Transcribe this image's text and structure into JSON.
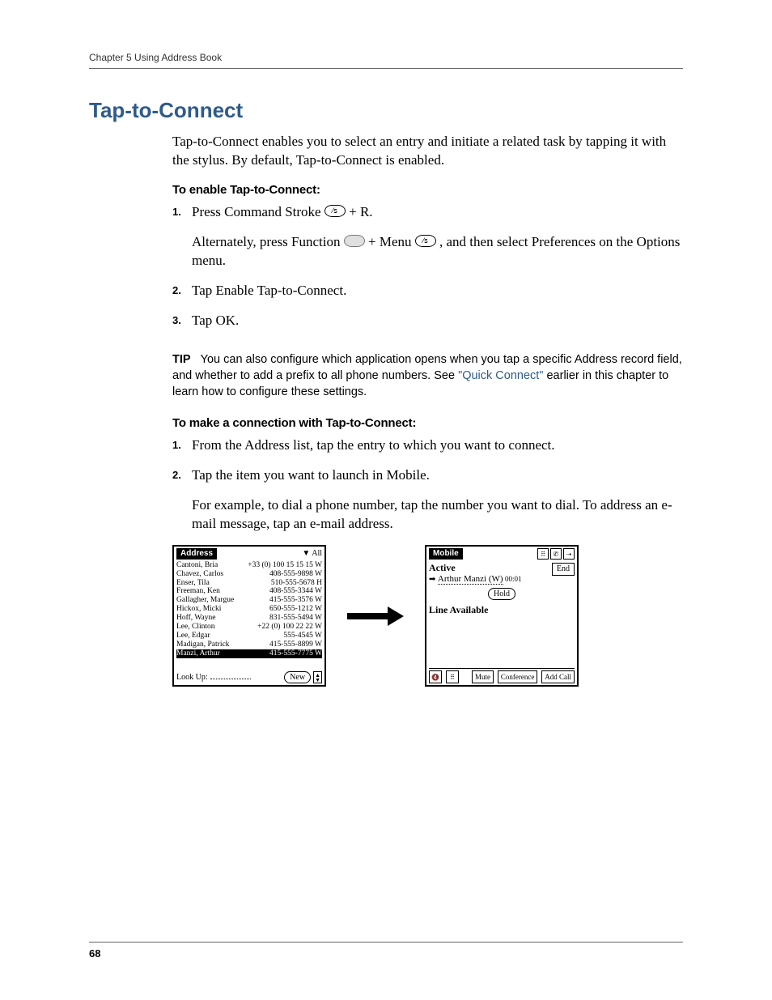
{
  "header": {
    "chapter": "Chapter 5   Using Address Book"
  },
  "section": {
    "title": "Tap-to-Connect"
  },
  "intro": "Tap-to-Connect enables you to select an entry and initiate a related task by tapping it with the stylus. By default, Tap-to-Connect is enabled.",
  "enable": {
    "heading": "To enable Tap-to-Connect:",
    "step1_a": "Press Command Stroke ",
    "step1_b": " + R.",
    "alt_a": "Alternately, press Function ",
    "alt_b": " + Menu ",
    "alt_c": ", and then select Preferences on the Options menu.",
    "step2": "Tap Enable Tap-to-Connect.",
    "step3": "Tap OK."
  },
  "tip": {
    "label": "TIP",
    "body_a": "You can also configure which application opens when you tap a specific Address record field, and whether to add a prefix to all phone numbers. See ",
    "link": "\"Quick Connect\"",
    "body_b": " earlier in this chapter to learn how to configure these settings."
  },
  "make": {
    "heading": "To make a connection with Tap-to-Connect:",
    "step1": "From the Address list, tap the entry to which you want to connect.",
    "step2": "Tap the item you want to launch in Mobile.",
    "example": "For example, to dial a phone number, tap the number you want to dial. To address an e-mail message, tap an e-mail address."
  },
  "address": {
    "title": "Address",
    "filter": "All",
    "rows": [
      {
        "name": "Cantoni, Bria",
        "num": "+33 (0) 100 15 15 15 W"
      },
      {
        "name": "Chavez, Carlos",
        "num": "408-555-9898 W"
      },
      {
        "name": "Enser, Tila",
        "num": "510-555-5678 H"
      },
      {
        "name": "Freeman, Ken",
        "num": "408-555-3344 W"
      },
      {
        "name": "Gallagher, Margue",
        "num": "415-555-3576 W"
      },
      {
        "name": "Hickox, Micki",
        "num": "650-555-1212 W"
      },
      {
        "name": "Hoff, Wayne",
        "num": "831-555-5494 W"
      },
      {
        "name": "Lee, Clinton",
        "num": "+22 (0) 100 22 22 W"
      },
      {
        "name": "Lee, Edgar",
        "num": "555-4545 W"
      },
      {
        "name": "Madigan, Patrick",
        "num": "415-555-8899 W"
      },
      {
        "name": "Manzi, Arthur",
        "num": "415-555-7775 W"
      }
    ],
    "lookup": "Look Up:",
    "new": "New"
  },
  "mobile": {
    "title": "Mobile",
    "active": "Active",
    "caller": "Arthur Manzi (W)",
    "timer": "00:01",
    "end": "End",
    "hold": "Hold",
    "line": "Line Available",
    "mute": "Mute",
    "conf": "Conference",
    "addcall": "Add Call"
  },
  "pagenum": "68"
}
